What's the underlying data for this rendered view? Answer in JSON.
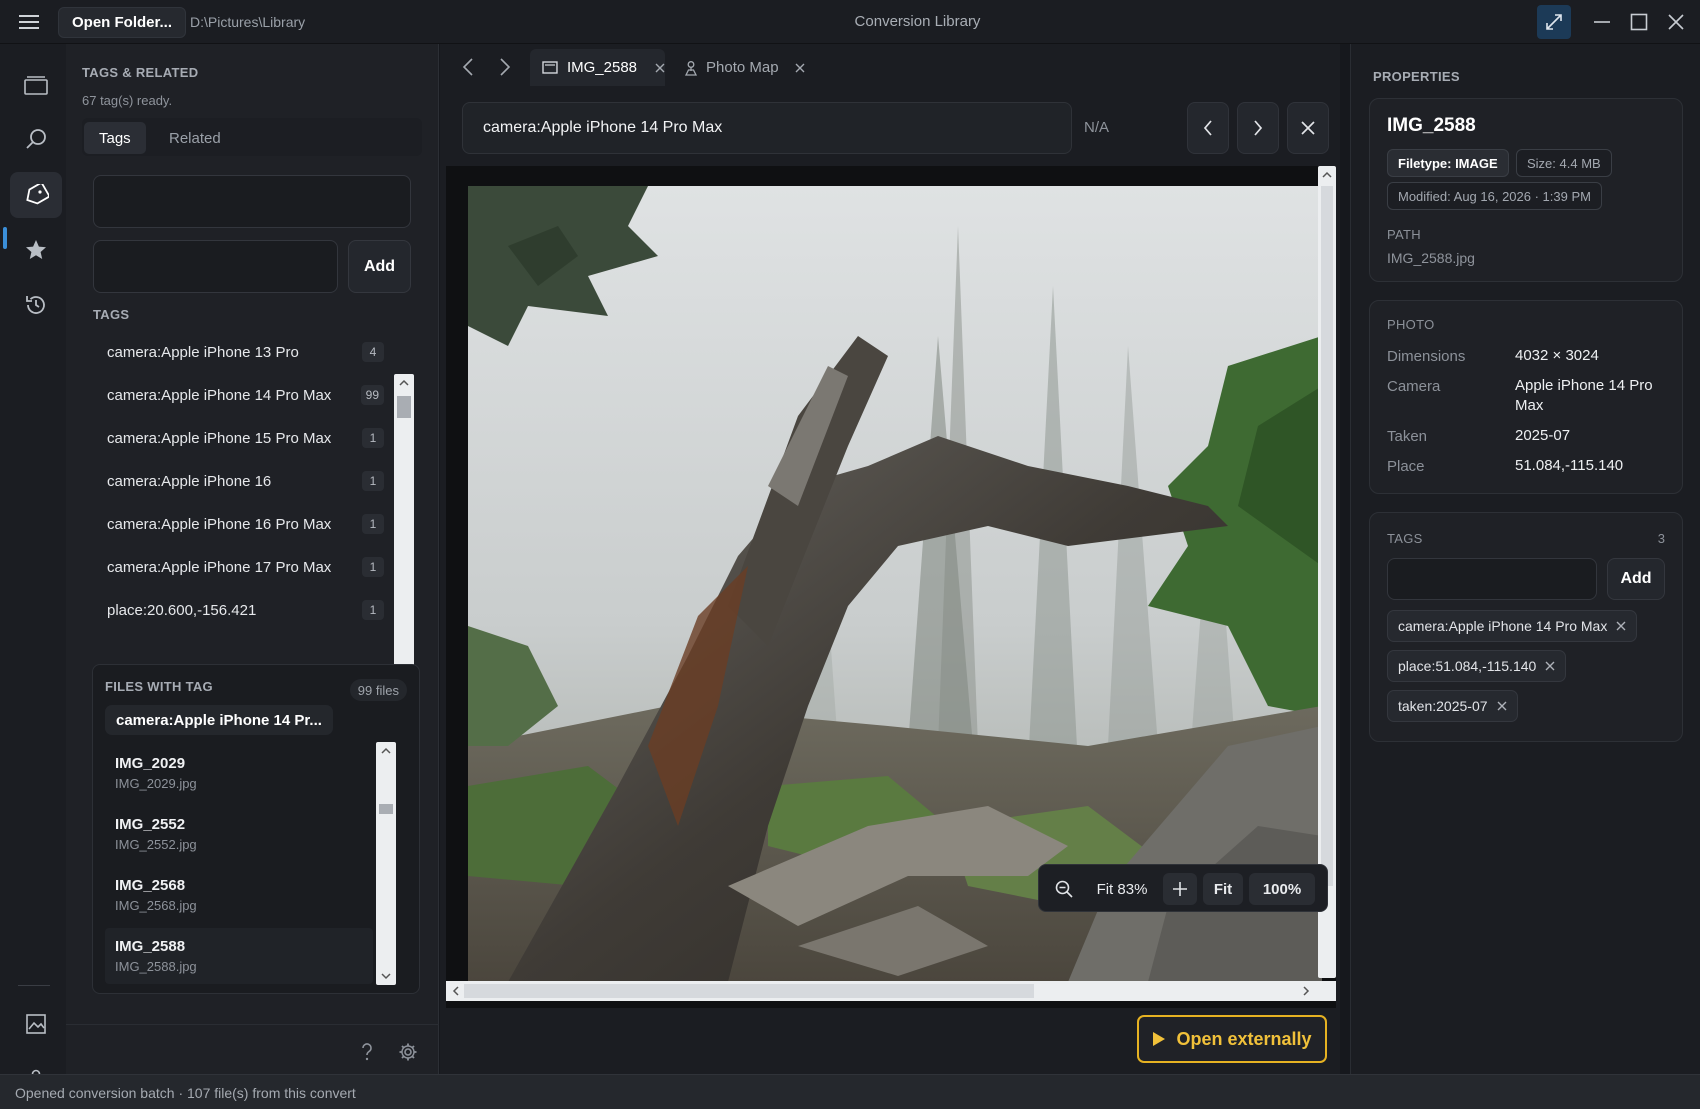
{
  "titlebar": {
    "open_folder_label": "Open Folder...",
    "path": "D:\\Pictures\\Library",
    "app_title": "Conversion Library"
  },
  "left_panel": {
    "heading": "TAGS & RELATED",
    "status": "67 tag(s) ready.",
    "tabs": [
      {
        "label": "Tags",
        "active": true
      },
      {
        "label": "Related",
        "active": false
      }
    ],
    "filter_value": "",
    "new_tag_value": "",
    "add_label": "Add",
    "tags_heading": "TAGS",
    "tags": [
      {
        "name": "camera:Apple iPhone 13 Pro",
        "count": "4"
      },
      {
        "name": "camera:Apple iPhone 14 Pro Max",
        "count": "99"
      },
      {
        "name": "camera:Apple iPhone 15 Pro Max",
        "count": "1"
      },
      {
        "name": "camera:Apple iPhone 16",
        "count": "1"
      },
      {
        "name": "camera:Apple iPhone 16 Pro Max",
        "count": "1"
      },
      {
        "name": "camera:Apple iPhone 17 Pro Max",
        "count": "1"
      },
      {
        "name": "place:20.600,-156.421",
        "count": "1"
      }
    ],
    "files_with_tag": {
      "heading": "FILES WITH TAG",
      "count_label": "99 files",
      "selected_tag": "camera:Apple iPhone 14 Pr...",
      "files": [
        {
          "name": "IMG_2029",
          "file": "IMG_2029.jpg"
        },
        {
          "name": "IMG_2552",
          "file": "IMG_2552.jpg"
        },
        {
          "name": "IMG_2568",
          "file": "IMG_2568.jpg"
        },
        {
          "name": "IMG_2588",
          "file": "IMG_2588.jpg"
        }
      ]
    }
  },
  "center": {
    "tabs": [
      {
        "label": "IMG_2588",
        "active": true
      },
      {
        "label": "Photo Map",
        "active": false
      }
    ],
    "search_value": "camera:Apple iPhone 14 Pro Max",
    "match_status": "N/A",
    "zoom": {
      "fit_percent_label": "Fit 83%",
      "fit_label": "Fit",
      "actual_label": "100%"
    },
    "open_externally_label": "Open externally"
  },
  "properties": {
    "heading": "PROPERTIES",
    "title": "IMG_2588",
    "filetype": "Filetype: IMAGE",
    "size": "Size: 4.4 MB",
    "modified": "Modified: Aug 16, 2026 · 1:39 PM",
    "path_label": "PATH",
    "path_value": "IMG_2588.jpg",
    "photo_heading": "PHOTO",
    "photo_fields": [
      {
        "key": "Dimensions",
        "value": "4032 × 3024"
      },
      {
        "key": "Camera",
        "value": "Apple iPhone 14 Pro Max"
      },
      {
        "key": "Taken",
        "value": "2025-07"
      },
      {
        "key": "Place",
        "value": "51.084,-115.140"
      }
    ],
    "tags_heading": "TAGS",
    "tags_count": "3",
    "tag_input_value": "",
    "add_label": "Add",
    "tags": [
      "camera:Apple iPhone 14 Pro Max",
      "place:51.084,-115.140",
      "taken:2025-07"
    ]
  },
  "statusbar": {
    "text": "Opened conversion batch · 107 file(s) from this convert"
  },
  "colors": {
    "accent": "#3b8fd9",
    "open_externally": "#e6b222"
  }
}
